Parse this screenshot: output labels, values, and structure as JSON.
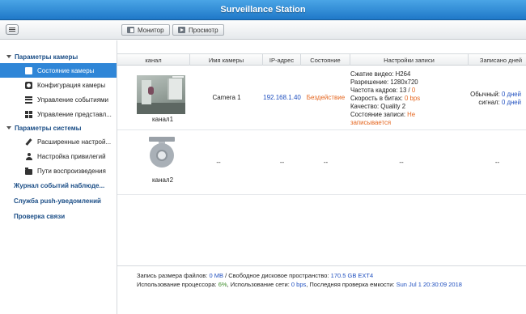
{
  "app": {
    "title": "Surveillance Station"
  },
  "toolbar": {
    "monitor_label": "Монитор",
    "view_label": "Просмотр"
  },
  "sidebar": {
    "camera_params": {
      "label": "Параметры камеры",
      "items": [
        {
          "label": "Состояние камеры",
          "icon": "camera-icon",
          "active": true
        },
        {
          "label": "Конфигурация камеры",
          "icon": "camera-config-icon"
        },
        {
          "label": "Управление событиями",
          "icon": "event-list-icon"
        },
        {
          "label": "Управление представл...",
          "icon": "grid-icon"
        }
      ]
    },
    "system_params": {
      "label": "Параметры системы",
      "items": [
        {
          "label": "Расширенные настрой...",
          "icon": "wrench-icon"
        },
        {
          "label": "Настройка привилегий",
          "icon": "user-icon"
        },
        {
          "label": "Пути воспроизведения",
          "icon": "folder-icon"
        }
      ]
    },
    "links": [
      "Журнал событий наблюде...",
      "Служба push-уведомлений",
      "Проверка связи"
    ]
  },
  "table": {
    "headers": [
      "канал",
      "Имя камеры",
      "IP-адрес",
      "Состояние",
      "Настройки записи",
      "Записано дней"
    ],
    "rows": [
      {
        "channel": "канал1",
        "name": "Camera 1",
        "ip": "192.168.1.40",
        "status": "Бездействие",
        "settings": {
          "codec": "Сжатие видео: H264",
          "resolution": "Разрешение: 1280x720",
          "fps_prefix": "Частота кадров: 13 / ",
          "fps_value": "0",
          "bitrate_prefix": "Скорость в битах: ",
          "bitrate_value": "0 bps",
          "quality": "Качество: Quality 2",
          "rec_state_prefix": "Состояние записи: ",
          "rec_state_line1": "Не",
          "rec_state_line2": "записывается"
        },
        "recorded": {
          "normal_prefix": "Обычный: ",
          "normal_value": "0 дней",
          "signal_prefix": "сигнал: ",
          "signal_value": "0 дней"
        }
      },
      {
        "channel": "канал2",
        "name": "--",
        "ip": "--",
        "status": "--",
        "settings": "--",
        "recorded": "--"
      }
    ]
  },
  "footer": {
    "line1_prefix": "Запись размера файлов: ",
    "file_size": "0 MB",
    "line1_mid": " / Свободное дисковое пространство: ",
    "free_space": "170.5 GB EXT4",
    "line2_prefix": "Использование процессора: ",
    "cpu": "6%",
    "line2_mid": ", Использование сети: ",
    "network": "0 bps",
    "line2_mid2": ", Последняя проверка емкости: ",
    "last_check": "Sun Jul 1 20:30:09 2018"
  },
  "colors": {
    "title_bar": "#2d8ad7",
    "active_item": "#2f86d7",
    "link": "#1a4d86",
    "ip": "#1f4fbf",
    "warning": "#e5661f",
    "cpu": "#3c8c2a"
  }
}
